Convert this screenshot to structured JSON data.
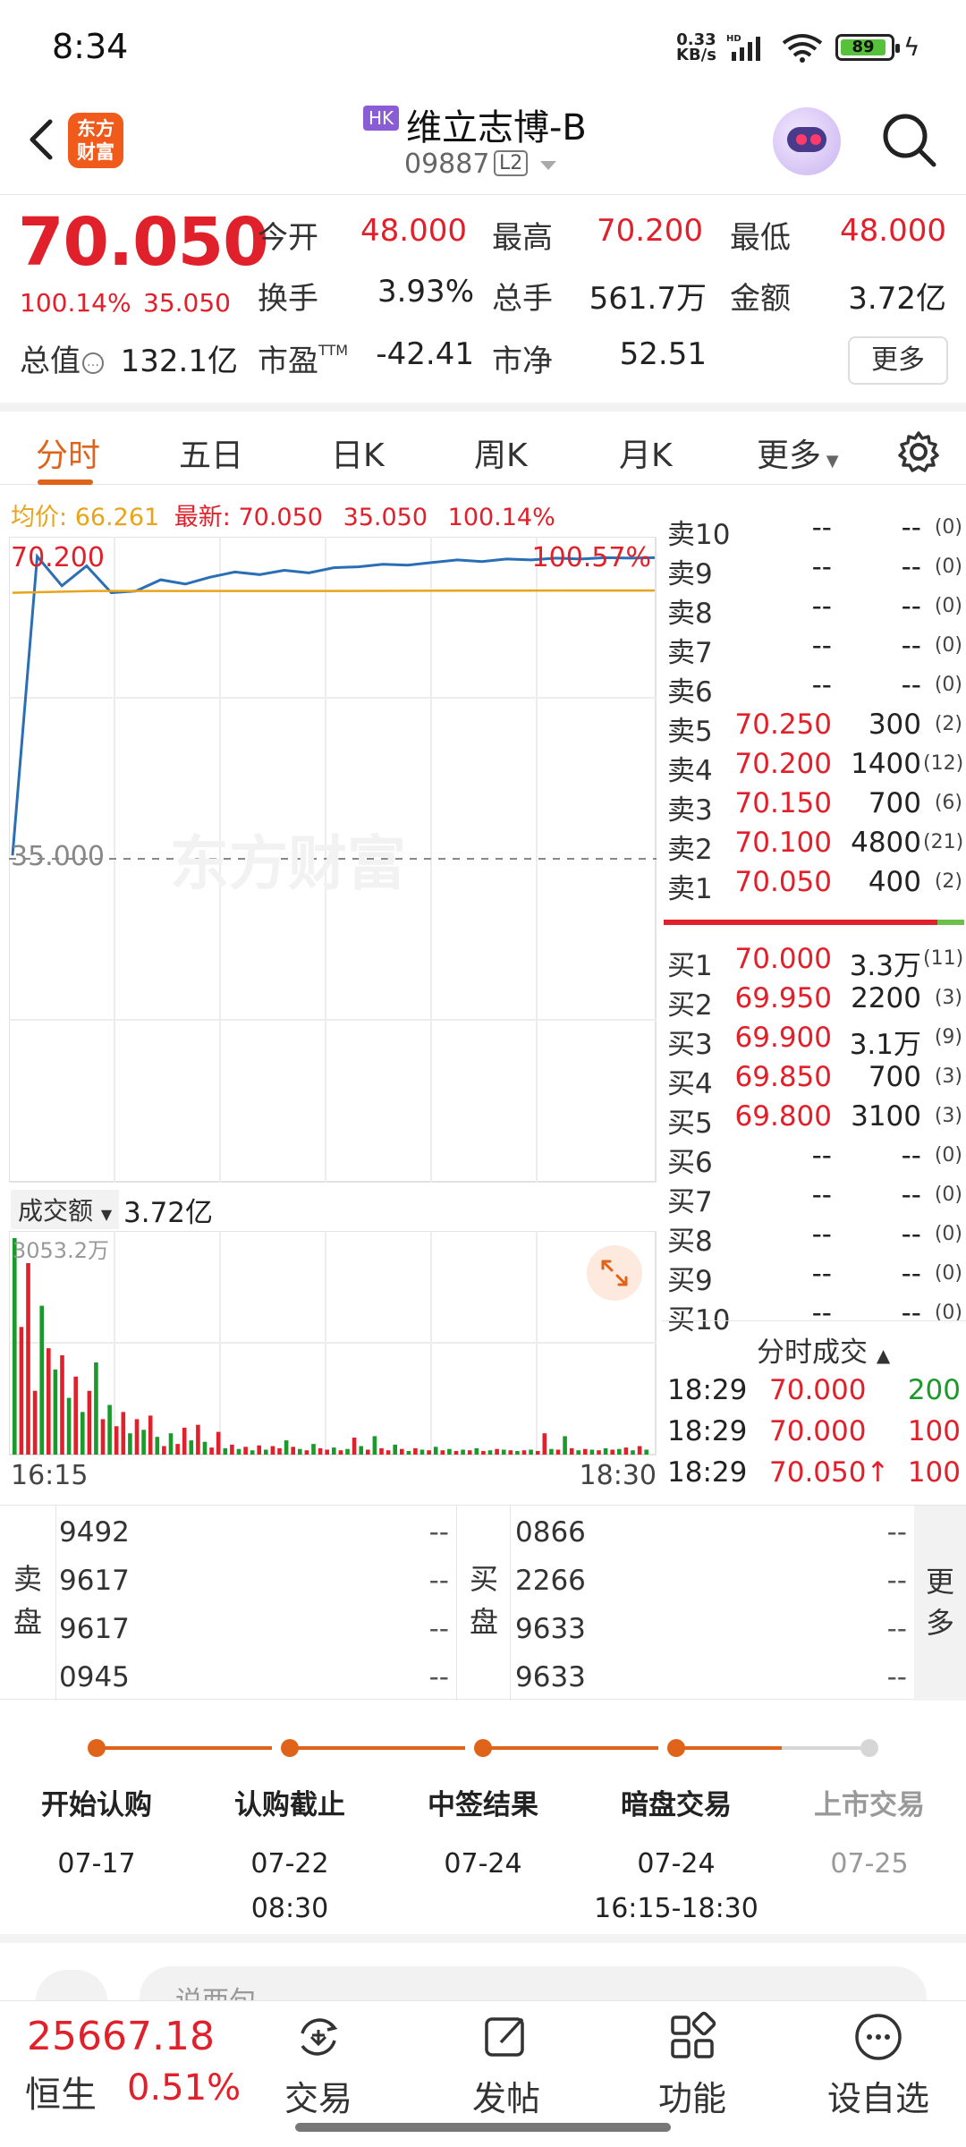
{
  "status_bar": {
    "time": "8:34",
    "net_speed": "0.33",
    "net_unit": "KB/s",
    "hd": "HD",
    "battery": "89"
  },
  "header": {
    "logo_line1": "东方",
    "logo_line2": "财富",
    "market_badge": "HK",
    "stock_name": "维立志博-B",
    "stock_code": "09887",
    "level_badge": "L2"
  },
  "quote": {
    "price": "70.050",
    "change_pct": "100.14%",
    "change": "35.050",
    "open_label": "今开",
    "open": "48.000",
    "high_label": "最高",
    "high": "70.200",
    "low_label": "最低",
    "low": "48.000",
    "turnover_label": "换手",
    "turnover": "3.93%",
    "volume_label": "总手",
    "volume": "561.7万",
    "amount_label": "金额",
    "amount": "3.72亿",
    "mktcap_label": "总值",
    "mktcap": "132.1亿",
    "pe_label": "市盈",
    "pe_sup": "TTM",
    "pe": "-42.41",
    "pb_label": "市净",
    "pb": "52.51",
    "more_button": "更多",
    "info_glyph": "…"
  },
  "tabs": [
    {
      "label": "分时",
      "active": true
    },
    {
      "label": "五日"
    },
    {
      "label": "日K"
    },
    {
      "label": "周K"
    },
    {
      "label": "月K"
    },
    {
      "label": "更多"
    }
  ],
  "avg_row": {
    "avg_label": "均价:",
    "avg_value": "66.261",
    "latest_label": "最新:",
    "latest_value": "70.050",
    "latest_change": "35.050",
    "latest_pct": "100.14%"
  },
  "chart_labels": {
    "price_max": "70.200",
    "pct_max": "100.57%",
    "price_mid": "35.000",
    "watermark": "东方财富",
    "volume_selector": "成交额",
    "volume_total": "3.72亿",
    "volume_max": "3053.2万",
    "time_start": "16:15",
    "time_end": "18:30"
  },
  "chart_data": {
    "type": "line",
    "x": [
      "16:15",
      "18:30"
    ],
    "series": [
      {
        "values": [
          35.6,
          70.2,
          66.8,
          69.1,
          66.0,
          66.2,
          67.5,
          67.0,
          67.8,
          68.4,
          68.1,
          68.6,
          68.3,
          68.9,
          69.0,
          69.3,
          69.2,
          69.5,
          69.8,
          69.6,
          69.9,
          69.8,
          70.0,
          69.9,
          70.05,
          70.0,
          70.05
        ],
        "color": "#2a6fb5"
      },
      {
        "values": [
          66.0,
          66.2,
          66.2,
          66.2,
          66.2,
          66.22,
          66.24,
          66.25,
          66.26
        ],
        "color": "#e8a41a"
      }
    ],
    "ylim": [
      0,
      70.2
    ],
    "volume_bars": [
      {
        "v": 3053.2,
        "c": "g"
      },
      {
        "v": 1800,
        "c": "r"
      },
      {
        "v": 2700,
        "c": "r"
      },
      {
        "v": 900,
        "c": "r"
      },
      {
        "v": 2100,
        "c": "g"
      },
      {
        "v": 1500,
        "c": "r"
      },
      {
        "v": 1200,
        "c": "g"
      },
      {
        "v": 1400,
        "c": "r"
      },
      {
        "v": 800,
        "c": "g"
      },
      {
        "v": 1100,
        "c": "r"
      },
      {
        "v": 600,
        "c": "g"
      },
      {
        "v": 900,
        "c": "r"
      },
      {
        "v": 1300,
        "c": "g"
      },
      {
        "v": 500,
        "c": "r"
      },
      {
        "v": 700,
        "c": "g"
      },
      {
        "v": 400,
        "c": "r"
      },
      {
        "v": 600,
        "c": "r"
      },
      {
        "v": 300,
        "c": "g"
      },
      {
        "v": 500,
        "c": "r"
      },
      {
        "v": 350,
        "c": "g"
      },
      {
        "v": 550,
        "c": "r"
      },
      {
        "v": 250,
        "c": "g"
      },
      {
        "v": 120,
        "c": "r"
      },
      {
        "v": 300,
        "c": "g"
      },
      {
        "v": 150,
        "c": "r"
      },
      {
        "v": 380,
        "c": "r"
      },
      {
        "v": 200,
        "c": "g"
      },
      {
        "v": 420,
        "c": "r"
      },
      {
        "v": 180,
        "c": "g"
      },
      {
        "v": 100,
        "c": "r"
      },
      {
        "v": 320,
        "c": "r"
      },
      {
        "v": 90,
        "c": "g"
      },
      {
        "v": 140,
        "c": "r"
      },
      {
        "v": 80,
        "c": "g"
      },
      {
        "v": 110,
        "c": "r"
      },
      {
        "v": 60,
        "c": "g"
      },
      {
        "v": 130,
        "c": "r"
      },
      {
        "v": 70,
        "c": "g"
      },
      {
        "v": 120,
        "c": "r"
      },
      {
        "v": 90,
        "c": "r"
      },
      {
        "v": 200,
        "c": "g"
      },
      {
        "v": 110,
        "c": "r"
      },
      {
        "v": 80,
        "c": "g"
      },
      {
        "v": 60,
        "c": "r"
      },
      {
        "v": 150,
        "c": "g"
      },
      {
        "v": 90,
        "c": "r"
      },
      {
        "v": 70,
        "c": "r"
      },
      {
        "v": 100,
        "c": "g"
      },
      {
        "v": 60,
        "c": "r"
      },
      {
        "v": 80,
        "c": "g"
      },
      {
        "v": 240,
        "c": "r"
      },
      {
        "v": 120,
        "c": "g"
      },
      {
        "v": 70,
        "c": "r"
      },
      {
        "v": 260,
        "c": "g"
      },
      {
        "v": 90,
        "c": "r"
      },
      {
        "v": 60,
        "c": "r"
      },
      {
        "v": 140,
        "c": "g"
      },
      {
        "v": 80,
        "c": "r"
      },
      {
        "v": 50,
        "c": "g"
      },
      {
        "v": 90,
        "c": "r"
      },
      {
        "v": 70,
        "c": "g"
      },
      {
        "v": 60,
        "c": "r"
      },
      {
        "v": 110,
        "c": "g"
      },
      {
        "v": 60,
        "c": "r"
      },
      {
        "v": 80,
        "c": "g"
      },
      {
        "v": 50,
        "c": "r"
      },
      {
        "v": 70,
        "c": "g"
      },
      {
        "v": 60,
        "c": "r"
      },
      {
        "v": 90,
        "c": "g"
      },
      {
        "v": 50,
        "c": "r"
      },
      {
        "v": 60,
        "c": "g"
      },
      {
        "v": 80,
        "c": "r"
      },
      {
        "v": 70,
        "c": "g"
      },
      {
        "v": 60,
        "c": "r"
      },
      {
        "v": 50,
        "c": "g"
      },
      {
        "v": 60,
        "c": "r"
      },
      {
        "v": 70,
        "c": "g"
      },
      {
        "v": 50,
        "c": "r"
      },
      {
        "v": 300,
        "c": "r"
      },
      {
        "v": 80,
        "c": "g"
      },
      {
        "v": 70,
        "c": "r"
      },
      {
        "v": 260,
        "c": "g"
      },
      {
        "v": 90,
        "c": "r"
      },
      {
        "v": 60,
        "c": "g"
      },
      {
        "v": 80,
        "c": "r"
      },
      {
        "v": 70,
        "c": "g"
      },
      {
        "v": 60,
        "c": "r"
      },
      {
        "v": 90,
        "c": "g"
      },
      {
        "v": 70,
        "c": "r"
      },
      {
        "v": 80,
        "c": "g"
      },
      {
        "v": 100,
        "c": "r"
      },
      {
        "v": 60,
        "c": "g"
      },
      {
        "v": 120,
        "c": "r"
      },
      {
        "v": 70,
        "c": "g"
      }
    ]
  },
  "order_book": {
    "asks": [
      {
        "label": "卖10",
        "price": "--",
        "volume": "--",
        "count": "(0)"
      },
      {
        "label": "卖9",
        "price": "--",
        "volume": "--",
        "count": "(0)"
      },
      {
        "label": "卖8",
        "price": "--",
        "volume": "--",
        "count": "(0)"
      },
      {
        "label": "卖7",
        "price": "--",
        "volume": "--",
        "count": "(0)"
      },
      {
        "label": "卖6",
        "price": "--",
        "volume": "--",
        "count": "(0)"
      },
      {
        "label": "卖5",
        "price": "70.250",
        "volume": "300",
        "count": "(2)"
      },
      {
        "label": "卖4",
        "price": "70.200",
        "volume": "1400",
        "count": "(12)"
      },
      {
        "label": "卖3",
        "price": "70.150",
        "volume": "700",
        "count": "(6)"
      },
      {
        "label": "卖2",
        "price": "70.100",
        "volume": "4800",
        "count": "(21)"
      },
      {
        "label": "卖1",
        "price": "70.050",
        "volume": "400",
        "count": "(2)"
      }
    ],
    "bids": [
      {
        "label": "买1",
        "price": "70.000",
        "volume": "3.3万",
        "count": "(11)"
      },
      {
        "label": "买2",
        "price": "69.950",
        "volume": "2200",
        "count": "(3)"
      },
      {
        "label": "买3",
        "price": "69.900",
        "volume": "3.1万",
        "count": "(9)"
      },
      {
        "label": "买4",
        "price": "69.850",
        "volume": "700",
        "count": "(3)"
      },
      {
        "label": "买5",
        "price": "69.800",
        "volume": "3100",
        "count": "(3)"
      },
      {
        "label": "买6",
        "price": "--",
        "volume": "--",
        "count": "(0)"
      },
      {
        "label": "买7",
        "price": "--",
        "volume": "--",
        "count": "(0)"
      },
      {
        "label": "买8",
        "price": "--",
        "volume": "--",
        "count": "(0)"
      },
      {
        "label": "买9",
        "price": "--",
        "volume": "--",
        "count": "(0)"
      },
      {
        "label": "买10",
        "price": "--",
        "volume": "--",
        "count": "(0)"
      }
    ]
  },
  "ticks": {
    "title": "分时成交",
    "rows": [
      {
        "time": "18:29",
        "price": "70.000",
        "volume": "200",
        "color": "green"
      },
      {
        "time": "18:29",
        "price": "70.000",
        "volume": "100",
        "color": "red"
      },
      {
        "time": "18:29",
        "price": "70.050↑",
        "volume": "100",
        "color": "red"
      }
    ]
  },
  "queue": {
    "sell_label": "卖盘",
    "buy_label": "买盘",
    "more_label": "更多",
    "sell": [
      {
        "broker": "9492",
        "val": "--"
      },
      {
        "broker": "9617",
        "val": "--"
      },
      {
        "broker": "9617",
        "val": "--"
      },
      {
        "broker": "0945",
        "val": "--"
      }
    ],
    "buy": [
      {
        "broker": "0866",
        "val": "--"
      },
      {
        "broker": "2266",
        "val": "--"
      },
      {
        "broker": "9633",
        "val": "--"
      },
      {
        "broker": "9633",
        "val": "--"
      }
    ]
  },
  "ipo_timeline": [
    {
      "title": "开始认购",
      "date": "07-17",
      "time": ""
    },
    {
      "title": "认购截止",
      "date": "07-22",
      "time": "08:30"
    },
    {
      "title": "中签结果",
      "date": "07-24",
      "time": ""
    },
    {
      "title": "暗盘交易",
      "date": "07-24",
      "time": "16:15-18:30"
    },
    {
      "title": "上市交易",
      "date": "07-25",
      "time": ""
    }
  ],
  "comment": {
    "placeholder": "说两句"
  },
  "bottom_bar": {
    "index_value": "25667.18",
    "index_name": "恒生",
    "index_pct": "0.51%",
    "nav": [
      {
        "label": "交易",
        "icon": "trade-icon"
      },
      {
        "label": "发帖",
        "icon": "post-icon"
      },
      {
        "label": "功能",
        "icon": "apps-icon"
      },
      {
        "label": "设自选",
        "icon": "more-circle-icon"
      }
    ]
  },
  "colors": {
    "up": "#e0202a",
    "down": "#1a9a2a",
    "accent": "#e0631a",
    "price_line": "#2a6fb5",
    "avg_line": "#e8a41a"
  }
}
